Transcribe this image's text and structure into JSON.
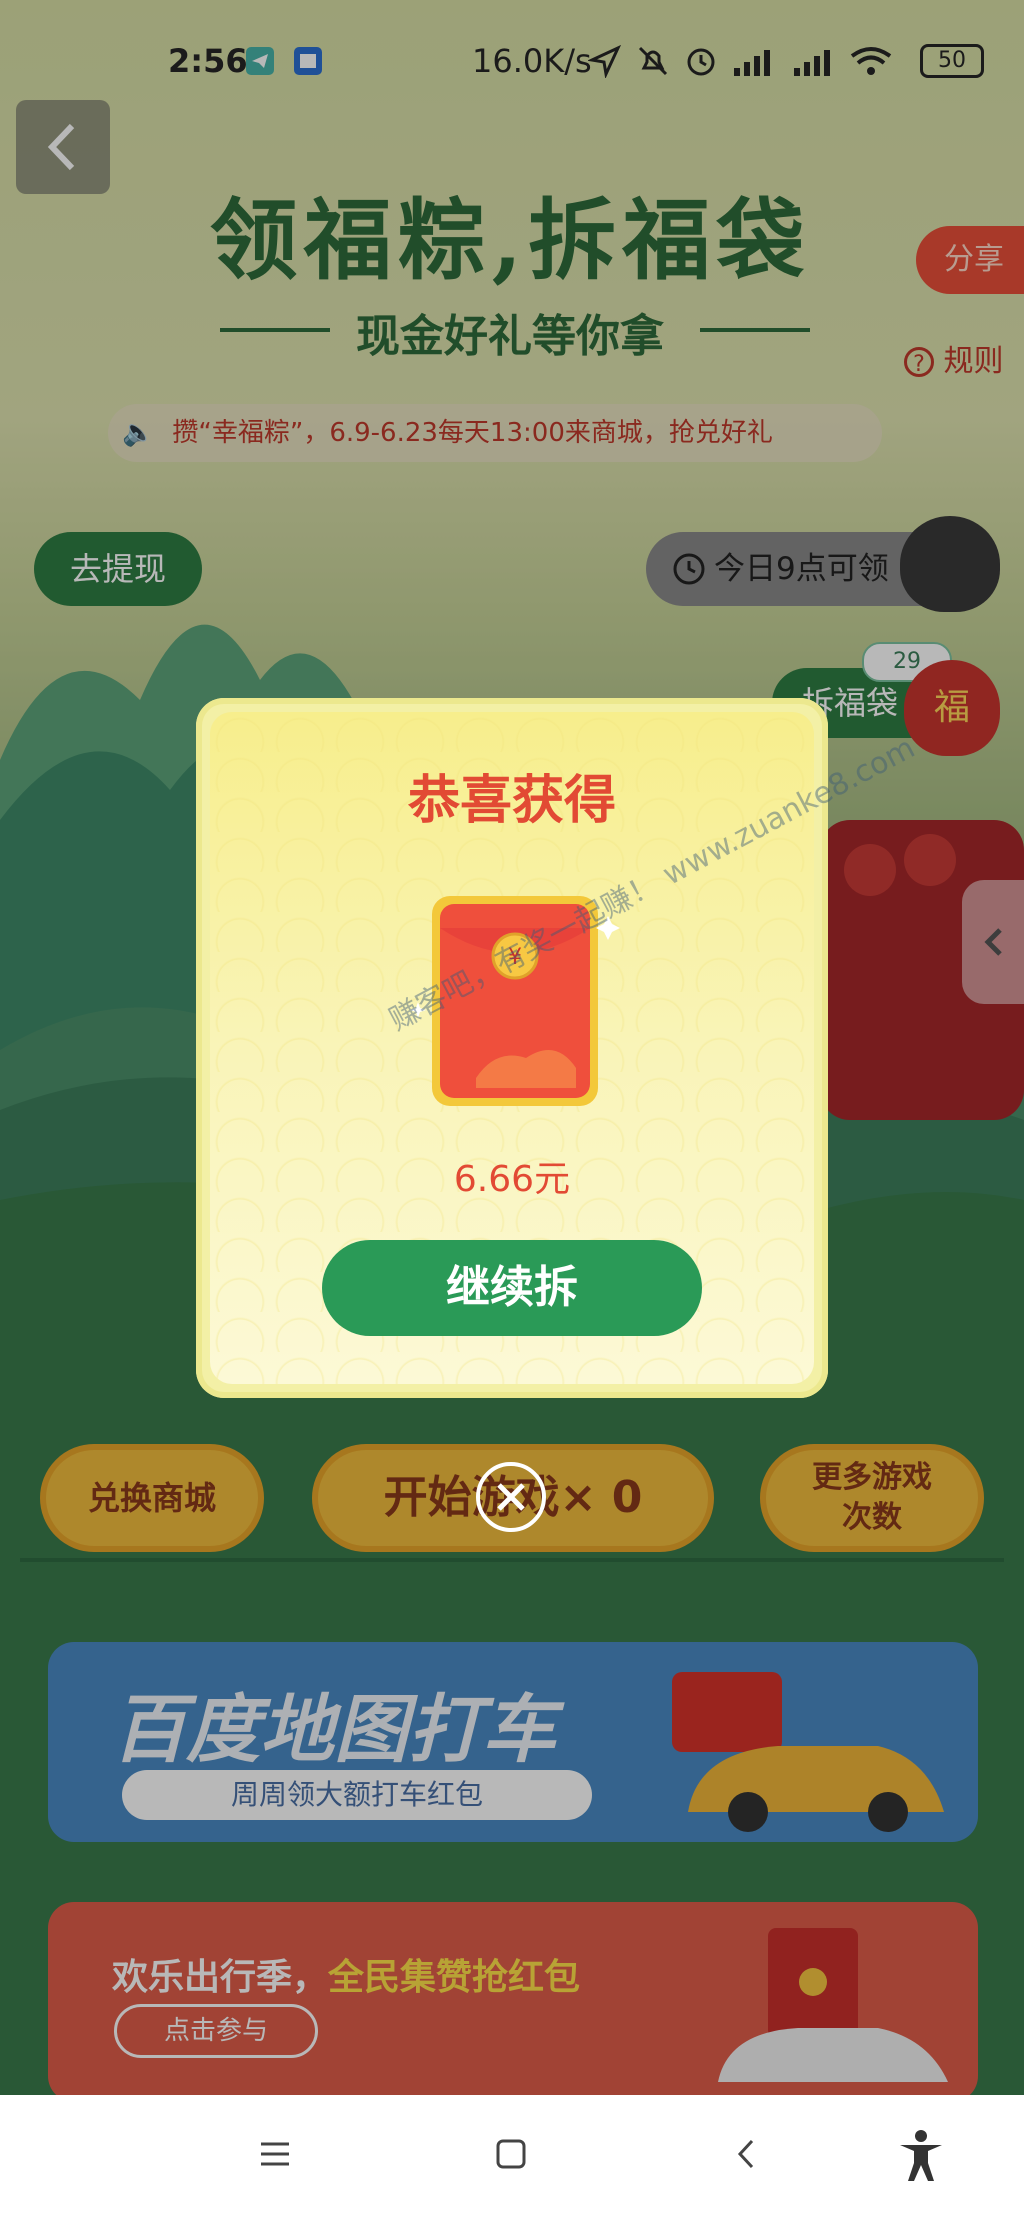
{
  "status_bar": {
    "time": "2:56",
    "net_speed": "16.0K/s",
    "battery": "50"
  },
  "header": {
    "title": "领福粽,拆福袋",
    "subtitle": "现金好礼等你拿",
    "share_label": "分享",
    "rules_label": "规则",
    "notice": "攒“幸福粽”，6.9-6.23每天13:00来商城，抢兑好礼"
  },
  "actions": {
    "withdraw_label": "去提现",
    "today_label": "今日9点可领",
    "bag_open_label": "拆福袋",
    "bag_count": "29",
    "bag_text": "福"
  },
  "modal": {
    "title": "恭喜获得",
    "amount": "6.66元",
    "continue_label": "继续拆"
  },
  "game_buttons": {
    "shop_label": "兑换商城",
    "play_label": "开始游戏",
    "play_count": "× 0",
    "more_label_line1": "更多游戏",
    "more_label_line2": "次数"
  },
  "banners": [
    {
      "title": "百度地图打车",
      "subtitle": "周周领大额打车红包"
    },
    {
      "title_prefix": "欢乐出行季，",
      "title_highlight": "全民集赞抢红包",
      "button": "点击参与"
    }
  ],
  "watermark": "赚客吧，有奖一起赚！ www.zuanke8.com",
  "colors": {
    "brand_green": "#2a9a57",
    "accent_red": "#e24a34",
    "gold": "#f1bd3d"
  }
}
